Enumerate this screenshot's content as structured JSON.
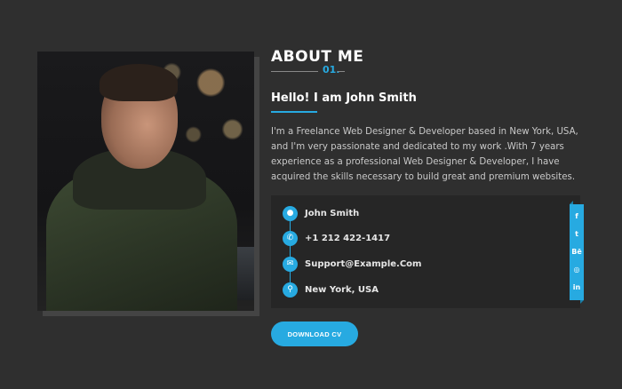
{
  "about": {
    "title": "ABOUT ME",
    "number": "01.",
    "greeting": "Hello! I am John Smith",
    "bio": "I'm a Freelance Web Designer & Developer based in New York, USA, and I'm very passionate and dedicated to my work .With 7 years experience as a professional Web Designer & Developer, I have acquired the skills necessary to build great and premium websites."
  },
  "info": [
    {
      "icon": "user-icon",
      "glyph": "●",
      "text": "John Smith"
    },
    {
      "icon": "phone-icon",
      "glyph": "✆",
      "text": "+1 212 422-1417"
    },
    {
      "icon": "envelope-icon",
      "glyph": "✉",
      "text": "Support@Example.Com"
    },
    {
      "icon": "map-pin-icon",
      "glyph": "⚲",
      "text": "New York, USA"
    }
  ],
  "social": [
    {
      "icon": "facebook-icon",
      "glyph": "f"
    },
    {
      "icon": "twitter-icon",
      "glyph": "t"
    },
    {
      "icon": "behance-icon",
      "glyph": "Bē"
    },
    {
      "icon": "dribbble-icon",
      "glyph": "◎"
    },
    {
      "icon": "linkedin-icon",
      "glyph": "in"
    }
  ],
  "button": {
    "label": "DOWNLOAD CV"
  },
  "colors": {
    "accent": "#27aae1",
    "background": "#2f2f2f",
    "card": "#262626"
  }
}
